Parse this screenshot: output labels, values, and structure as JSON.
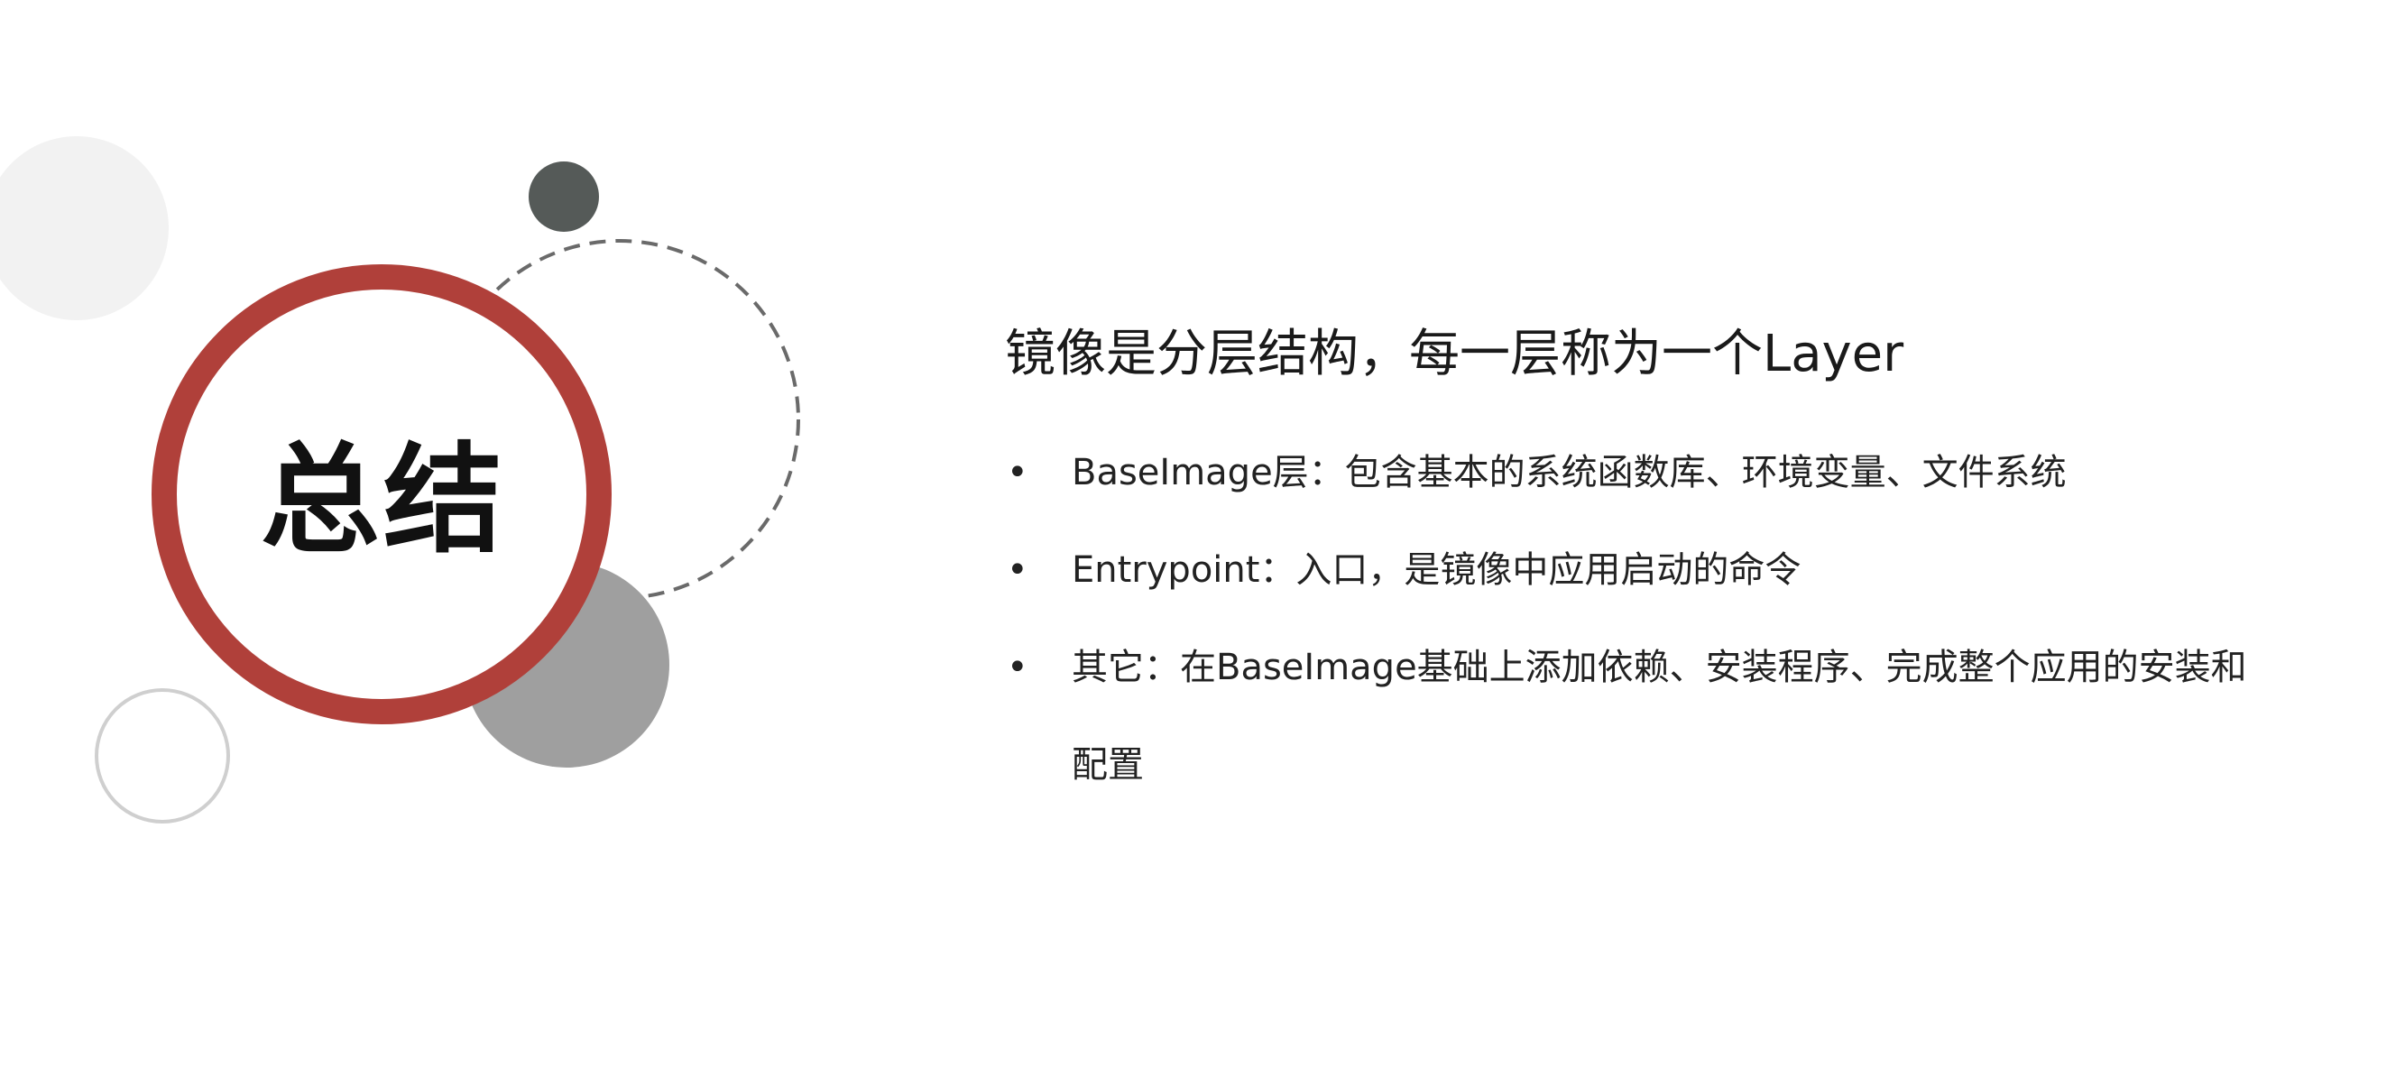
{
  "slide": {
    "title": "总结",
    "heading": "镜像是分层结构，每一层称为一个Layer",
    "bullet_symbol": "•",
    "bullets": [
      {
        "text": "BaseImage层：包含基本的系统函数库、环境变量、文件系统"
      },
      {
        "text": "Entrypoint：入口，是镜像中应用启动的命令"
      },
      {
        "text": "其它：在BaseImage基础上添加依赖、安装程序、完成整个应用的安装和配置"
      }
    ]
  },
  "colors": {
    "accent_ring": "#b0403a",
    "dark_dot": "#555a58",
    "gray_circle": "#9f9f9f",
    "light_circle": "#f2f2f2",
    "outline_circle": "#cfcfcf",
    "dashed_circle": "#6a6a6a"
  }
}
